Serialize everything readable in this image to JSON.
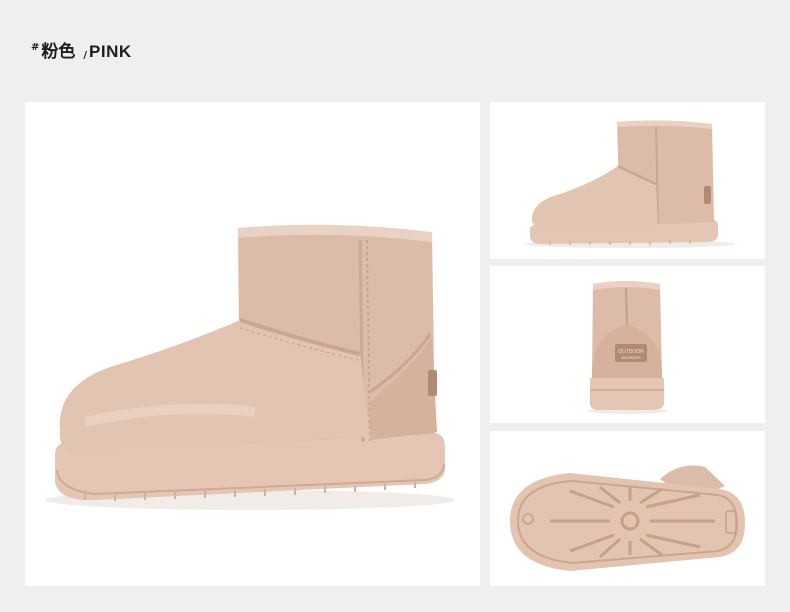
{
  "heading": {
    "hash": "#",
    "color_cn": "粉色",
    "separator": "/",
    "color_en": "PINK"
  },
  "colors": {
    "page_background": "#efefef",
    "panel_background": "#ffffff",
    "boot_suede": "#e0c2b0",
    "boot_shadow": "#cfae9b",
    "sole": "#e7cbbb",
    "stitching": "#c9a592"
  },
  "images": [
    {
      "name": "boot-three-quarter-view"
    },
    {
      "name": "boot-side-view"
    },
    {
      "name": "boot-back-view"
    },
    {
      "name": "boot-sole-view"
    }
  ],
  "badge": {
    "label_top": "OUTDOOR",
    "label_bottom": "WARRIOR"
  }
}
